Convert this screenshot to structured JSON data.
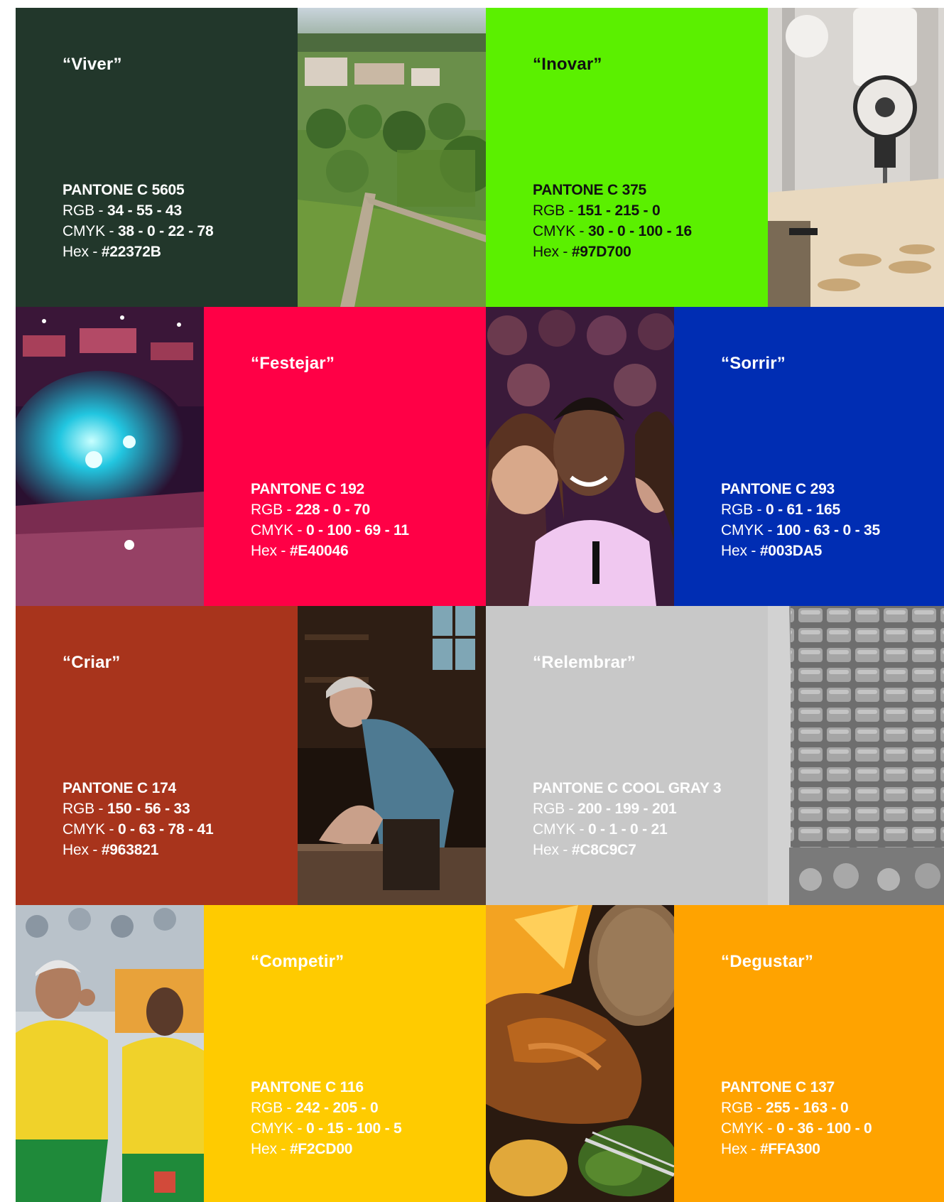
{
  "swatches": {
    "viver": {
      "quote": "“Viver”",
      "pantone_label": "PANTONE",
      "pantone_value": "C 5605",
      "rgb_label": "RGB - ",
      "rgb": "34 - 55 - 43",
      "cmyk_label": "CMYK - ",
      "cmyk": "38 - 0 - 22 - 78",
      "hex_label": "Hex - ",
      "hex": "#22372B",
      "color": "#22372B"
    },
    "inovar": {
      "quote": "“Inovar”",
      "pantone_label": "PANTONE",
      "pantone_value": "C 375",
      "rgb_label": "RGB - ",
      "rgb": "151 - 215 - 0",
      "cmyk_label": "CMYK - ",
      "cmyk": "30 - 0 - 100 - 16",
      "hex_label": "Hex - ",
      "hex": "#97D700",
      "color": "#5BF000"
    },
    "festejar": {
      "quote": "“Festejar”",
      "pantone_label": "PANTONE",
      "pantone_value": "C 192",
      "rgb_label": "RGB - ",
      "rgb": "228 - 0 - 70",
      "cmyk_label": "CMYK - ",
      "cmyk": "0 - 100 - 69 - 11",
      "hex_label": "Hex - ",
      "hex": "#E40046",
      "color": "#FF0046"
    },
    "sorrir": {
      "quote": "“Sorrir”",
      "pantone_label": "PANTONE",
      "pantone_value": "C 293",
      "rgb_label": "RGB - ",
      "rgb": "0 - 61 - 165",
      "cmyk_label": "CMYK - ",
      "cmyk": "100 - 63 - 0 - 35",
      "hex_label": "Hex - ",
      "hex": "#003DA5",
      "color": "#002DB3"
    },
    "criar": {
      "quote": "“Criar”",
      "pantone_label": "PANTONE",
      "pantone_value": "C 174",
      "rgb_label": "RGB - ",
      "rgb": "150 - 56 - 33",
      "cmyk_label": "CMYK - ",
      "cmyk": "0 - 63 - 78 - 41",
      "hex_label": "Hex - ",
      "hex": "#963821",
      "color": "#A8341C"
    },
    "relembrar": {
      "quote": "“Relembrar”",
      "pantone_label": "PANTONE",
      "pantone_value": "C COOL GRAY 3",
      "rgb_label": "RGB - ",
      "rgb": "200 - 199 - 201",
      "cmyk_label": "CMYK - ",
      "cmyk": "0 - 1 - 0 - 21",
      "hex_label": "Hex - ",
      "hex": "#C8C9C7",
      "color": "#C8C8C8"
    },
    "competir": {
      "quote": "“Competir”",
      "pantone_label": "PANTONE",
      "pantone_value": "C 116",
      "rgb_label": "RGB - ",
      "rgb": "242 - 205 - 0",
      "cmyk_label": "CMYK - ",
      "cmyk": "0 - 15 - 100 - 5",
      "hex_label": "Hex - ",
      "hex": "#F2CD00",
      "color": "#FFCB00"
    },
    "degustar": {
      "quote": "“Degustar”",
      "pantone_label": "PANTONE",
      "pantone_value": "C 137",
      "rgb_label": "RGB - ",
      "rgb": "255 - 163 - 0",
      "cmyk_label": "CMYK - ",
      "cmyk": "0 - 36 - 100 - 0",
      "hex_label": "Hex - ",
      "hex": "#FFA300",
      "color": "#FFA300"
    }
  },
  "photos": {
    "landscape": {
      "icon": "aerial-landscape-photo"
    },
    "robot": {
      "icon": "robotic-arm-photo"
    },
    "festival": {
      "icon": "festival-crowd-photo"
    },
    "friends": {
      "icon": "smiling-friends-photo"
    },
    "craftsman": {
      "icon": "craftsman-workshop-photo"
    },
    "stone": {
      "icon": "carved-stone-photo"
    },
    "football": {
      "icon": "football-players-photo"
    },
    "food": {
      "icon": "roast-dish-photo"
    }
  }
}
